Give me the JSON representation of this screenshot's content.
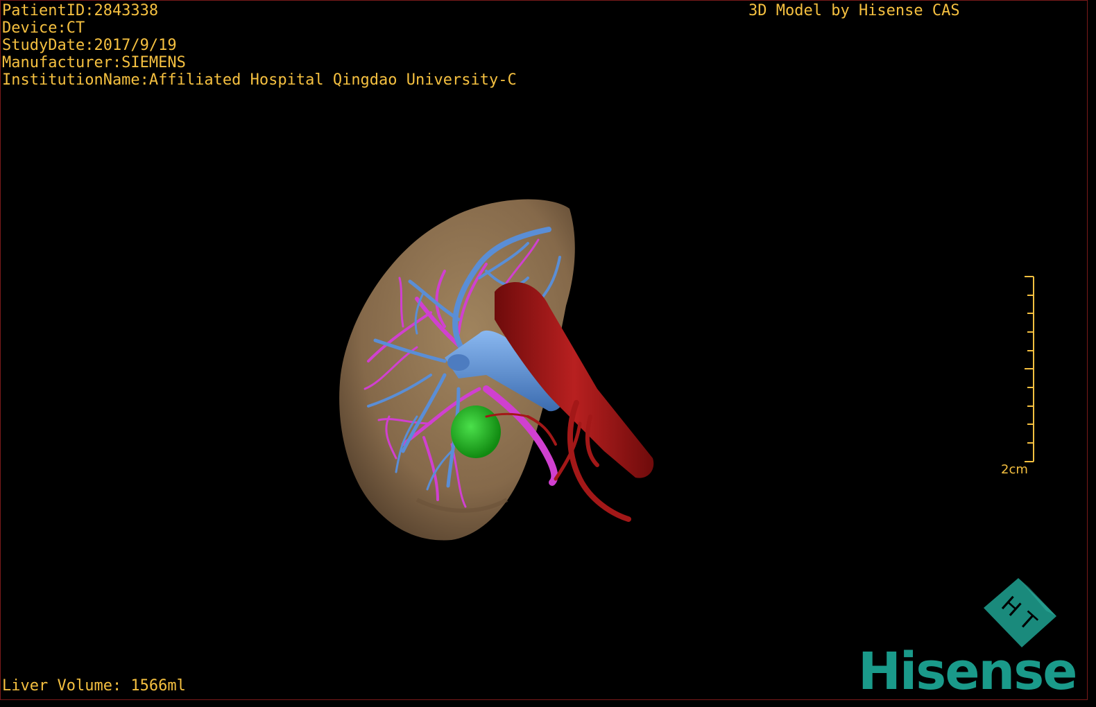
{
  "overlay": {
    "patient_id": "PatientID:2843338",
    "device": "Device:CT",
    "study_date": "StudyDate:2017/9/19",
    "manufacturer": "Manufacturer:SIEMENS",
    "institution": "InstitutionName:Affiliated Hospital Qingdao University-C"
  },
  "header": {
    "model_credit": "3D Model by Hisense CAS"
  },
  "footer": {
    "liver_volume": "Liver Volume: 1566ml"
  },
  "scale_bar": {
    "label": "2cm"
  },
  "logo": {
    "text": "Hisense",
    "mark_letters": "H T"
  },
  "colors": {
    "overlay_text": "#f5c040",
    "liver": "#8a6e4c",
    "portal_vein": "#5a8ed6",
    "hepatic_artery": "#d040d0",
    "ivc": "#a31818",
    "lesion": "#22b422",
    "brand": "#1a9a8a"
  }
}
